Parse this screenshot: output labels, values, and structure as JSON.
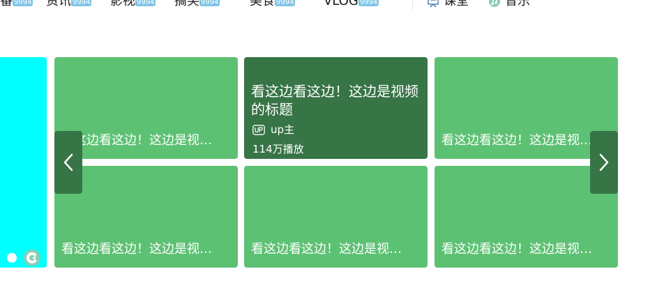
{
  "nav": {
    "items": [
      {
        "label": "番",
        "count": "9994"
      },
      {
        "label": "资讯",
        "count": "9994"
      },
      {
        "label": "影视",
        "count": "9994"
      },
      {
        "label": "搞笑",
        "count": "9994"
      },
      {
        "label": "美食",
        "count": "9994"
      },
      {
        "label": "VLOG",
        "count": "9994"
      }
    ],
    "links": [
      {
        "label": "课堂",
        "icon": "classroom-icon"
      },
      {
        "label": "音乐",
        "icon": "music-icon"
      }
    ]
  },
  "cards": {
    "short_title": "看这边看这边！这边是视频的标题",
    "active": {
      "title": "看这边看这边！这边是视频的标题",
      "up_name": "up主",
      "plays": "114万播放"
    }
  },
  "colors": {
    "card_green": "#5dc173",
    "card_dark": "#377446",
    "banner": "#00ffff",
    "count_badge": "#7fc4e6"
  }
}
